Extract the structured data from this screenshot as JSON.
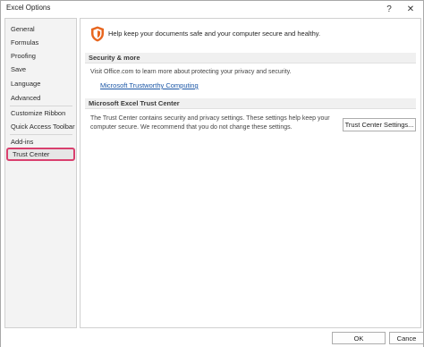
{
  "window": {
    "title": "Excel Options",
    "help_glyph": "?",
    "close_glyph": "✕"
  },
  "sidebar": {
    "items": [
      {
        "label": "General"
      },
      {
        "label": "Formulas"
      },
      {
        "label": "Proofing"
      },
      {
        "label": "Save"
      },
      {
        "label": "Language"
      },
      {
        "label": "Advanced"
      },
      {
        "label": "Customize Ribbon"
      },
      {
        "label": "Quick Access Toolbar"
      },
      {
        "label": "Add-ins"
      },
      {
        "label": "Trust Center"
      }
    ],
    "selected": "Trust Center"
  },
  "main": {
    "banner": {
      "icon": "shield-icon",
      "text": "Help keep your documents safe and your computer secure and healthy."
    },
    "security_more": {
      "header": "Security & more",
      "text": "Visit Office.com to learn more about protecting your privacy and security.",
      "link": "Microsoft Trustworthy Computing"
    },
    "trust_center": {
      "header": "Microsoft Excel Trust Center",
      "text_line1": "The Trust Center contains security and privacy settings. These settings help keep your",
      "text_line2": "computer secure. We recommend that you do not change these settings.",
      "button": "Trust Center Settings..."
    }
  },
  "footer": {
    "ok": "OK",
    "cancel": "Cance"
  },
  "colors": {
    "selection_outline": "#d9406e",
    "shield": "#e8661f",
    "link": "#1a56a6"
  }
}
